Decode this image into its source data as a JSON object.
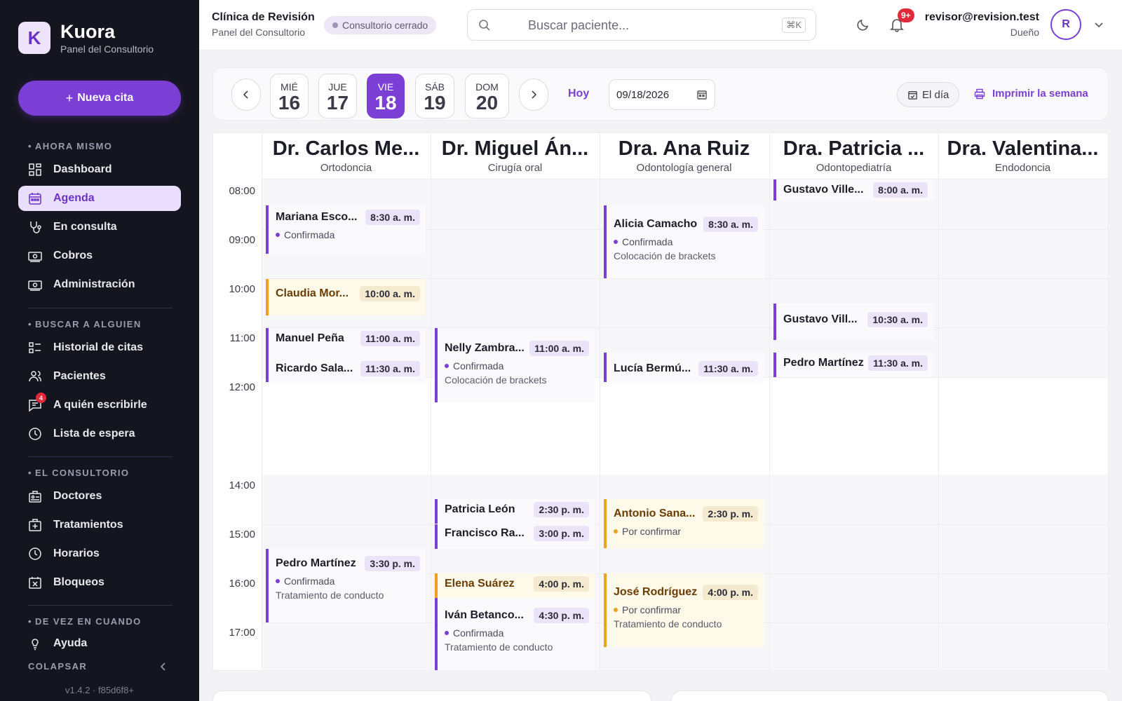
{
  "sidebar": {
    "brand": {
      "logo_letter": "K",
      "name": "Kuora",
      "subtitle": "Panel del Consultorio"
    },
    "new_appointment": "Nueva cita",
    "sections": [
      {
        "title": "AHORA MISMO"
      },
      {
        "title": "BUSCAR A ALGUIEN"
      },
      {
        "title": "EL CONSULTORIO"
      },
      {
        "title": "DE VEZ EN CUANDO"
      }
    ],
    "items": [
      {
        "label": "Dashboard",
        "icon": "dashboard-icon"
      },
      {
        "label": "Agenda",
        "icon": "calendar-icon",
        "active": true
      },
      {
        "label": "En consulta",
        "icon": "stethoscope-icon"
      },
      {
        "label": "Cobros",
        "icon": "cash-icon"
      },
      {
        "label": "Administración",
        "icon": "cash-icon"
      },
      {
        "label": "Historial de citas",
        "icon": "history-list-icon"
      },
      {
        "label": "Pacientes",
        "icon": "users-icon"
      },
      {
        "label": "A quién escribirle",
        "icon": "message-icon",
        "badge": "4"
      },
      {
        "label": "Lista de espera",
        "icon": "clock-icon"
      },
      {
        "label": "Doctores",
        "icon": "doctor-badge-icon"
      },
      {
        "label": "Tratamientos",
        "icon": "medical-kit-icon"
      },
      {
        "label": "Horarios",
        "icon": "clock-icon"
      },
      {
        "label": "Bloqueos",
        "icon": "calendar-x-icon"
      },
      {
        "label": "Ayuda",
        "icon": "lightbulb-icon"
      }
    ],
    "collapse": "COLAPSAR",
    "version": "v1.4.2 · f85d6f8+"
  },
  "header": {
    "clinic_name": "Clínica de Revisión",
    "clinic_sub": "Panel del Consultorio",
    "status": "Consultorio cerrado",
    "search_placeholder": "Buscar paciente...",
    "search_shortcut": "⌘K",
    "notifications_badge": "9+",
    "user_email": "revisor@revision.test",
    "user_role": "Dueño",
    "avatar_letter": "R"
  },
  "datebar": {
    "days": [
      {
        "dow": "MIÉ",
        "num": "16"
      },
      {
        "dow": "JUE",
        "num": "17"
      },
      {
        "dow": "VIE",
        "num": "18",
        "selected": true
      },
      {
        "dow": "SÁB",
        "num": "19"
      },
      {
        "dow": "DOM",
        "num": "20"
      }
    ],
    "today": "Hoy",
    "date_value": "09/18/2026",
    "day_view": "El día",
    "print": "Imprimir la semana"
  },
  "calendar": {
    "hours": [
      "08:00",
      "09:00",
      "10:00",
      "11:00",
      "12:00",
      "14:00",
      "15:00",
      "16:00",
      "17:00"
    ],
    "doctors": [
      {
        "name": "Dr. Carlos Me...",
        "specialty": "Ortodoncia"
      },
      {
        "name": "Dr. Miguel Án...",
        "specialty": "Cirugía oral"
      },
      {
        "name": "Dra. Ana Ruiz",
        "specialty": "Odontología general"
      },
      {
        "name": "Dra. Patricia ...",
        "specialty": "Odontopediatría"
      },
      {
        "name": "Dra. Valentina...",
        "specialty": "Endodoncia"
      }
    ],
    "appointments": [
      {
        "doctor": 0,
        "patient": "Mariana Esco...",
        "time": "8:30 a. m.",
        "status": "Confirmada"
      },
      {
        "doctor": 0,
        "patient": "Claudia Mor...",
        "time": "10:00 a. m.",
        "pending": true
      },
      {
        "doctor": 0,
        "patient": "Manuel Peña",
        "time": "11:00 a. m."
      },
      {
        "doctor": 0,
        "patient": "Ricardo Sala...",
        "time": "11:30 a. m."
      },
      {
        "doctor": 0,
        "patient": "Pedro Martínez",
        "time": "3:30 p. m.",
        "status": "Confirmada",
        "note": "Tratamiento de conducto"
      },
      {
        "doctor": 1,
        "patient": "Nelly Zambra...",
        "time": "11:00 a. m.",
        "status": "Confirmada",
        "note": "Colocación de brackets"
      },
      {
        "doctor": 1,
        "patient": "Patricia León",
        "time": "2:30 p. m."
      },
      {
        "doctor": 1,
        "patient": "Francisco Ra...",
        "time": "3:00 p. m."
      },
      {
        "doctor": 1,
        "patient": "Elena Suárez",
        "time": "4:00 p. m.",
        "pending": true
      },
      {
        "doctor": 1,
        "patient": "Iván Betanco...",
        "time": "4:30 p. m.",
        "status": "Confirmada",
        "note": "Tratamiento de conducto"
      },
      {
        "doctor": 2,
        "patient": "Alicia Camacho",
        "time": "8:30 a. m.",
        "status": "Confirmada",
        "note": "Colocación de brackets"
      },
      {
        "doctor": 2,
        "patient": "Lucía Bermú...",
        "time": "11:30 a. m."
      },
      {
        "doctor": 2,
        "patient": "Antonio Sana...",
        "time": "2:30 p. m.",
        "pending": true,
        "status": "Por confirmar"
      },
      {
        "doctor": 2,
        "patient": "José Rodríguez",
        "time": "4:00 p. m.",
        "pending": true,
        "status": "Por confirmar",
        "note": "Tratamiento de conducto"
      },
      {
        "doctor": 3,
        "patient": "Gustavo Ville...",
        "time": "8:00 a. m."
      },
      {
        "doctor": 3,
        "patient": "Gustavo Vill...",
        "time": "10:30 a. m."
      },
      {
        "doctor": 3,
        "patient": "Pedro Martínez",
        "time": "11:30 a. m."
      }
    ]
  },
  "colors": {
    "accent": "#7c3fd6",
    "pending": "#f0a020",
    "sidebar_bg": "#15151f"
  }
}
